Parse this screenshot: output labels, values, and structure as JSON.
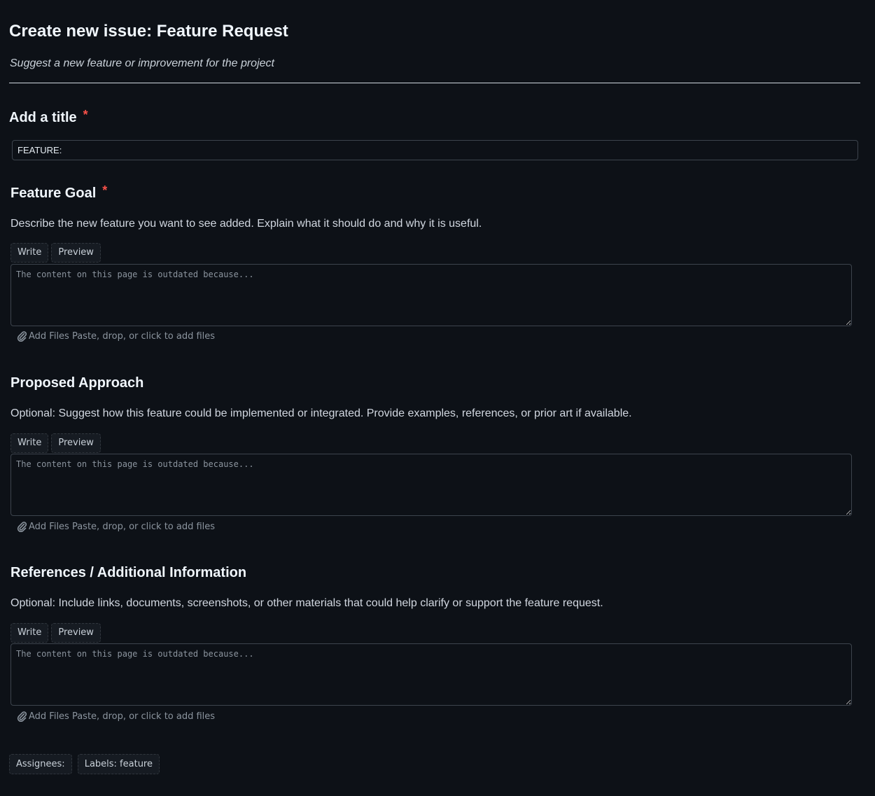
{
  "header": {
    "title": "Create new issue: Feature Request",
    "subtitle": "Suggest a new feature or improvement for the project"
  },
  "title_field": {
    "label": "Add a title",
    "required_marker": "*",
    "value": "FEATURE:"
  },
  "sections": [
    {
      "heading": "Feature Goal",
      "required_marker": "*",
      "description": "Describe the new feature you want to see added. Explain what it should do and why it is useful.",
      "write_label": "Write",
      "preview_label": "Preview",
      "placeholder": "The content on this page is outdated because...",
      "attach_label": "Add Files Paste, drop, or click to add files"
    },
    {
      "heading": "Proposed Approach",
      "required_marker": "",
      "description": "Optional: Suggest how this feature could be implemented or integrated. Provide examples, references, or prior art if available.",
      "write_label": "Write",
      "preview_label": "Preview",
      "placeholder": "The content on this page is outdated because...",
      "attach_label": "Add Files Paste, drop, or click to add files"
    },
    {
      "heading": "References / Additional Information",
      "required_marker": "",
      "description": "Optional: Include links, documents, screenshots, or other materials that could help clarify or support the feature request.",
      "write_label": "Write",
      "preview_label": "Preview",
      "placeholder": "The content on this page is outdated because...",
      "attach_label": "Add Files Paste, drop, or click to add files"
    }
  ],
  "footer": {
    "assignees_label": "Assignees:",
    "labels_label": "Labels: feature"
  },
  "colors": {
    "background": "#0d1117",
    "required": "#f85149",
    "muted_text": "#8b949e"
  },
  "icons": {
    "attach": "paperclip-icon"
  }
}
